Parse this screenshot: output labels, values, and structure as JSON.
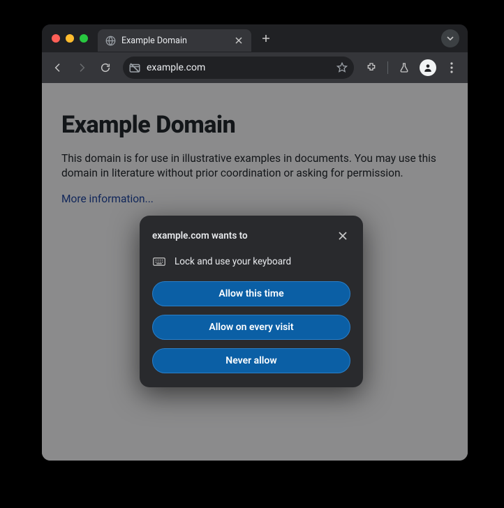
{
  "tab": {
    "title": "Example Domain"
  },
  "omnibox": {
    "url": "example.com"
  },
  "page": {
    "heading": "Example Domain",
    "paragraph": "This domain is for use in illustrative examples in documents. You may use this domain in literature without prior coordination or asking for permission.",
    "more_link": "More information..."
  },
  "permission_dialog": {
    "title": "example.com wants to",
    "request": "Lock and use your keyboard",
    "buttons": {
      "allow_once": "Allow this time",
      "allow_always": "Allow on every visit",
      "never": "Never allow"
    }
  }
}
